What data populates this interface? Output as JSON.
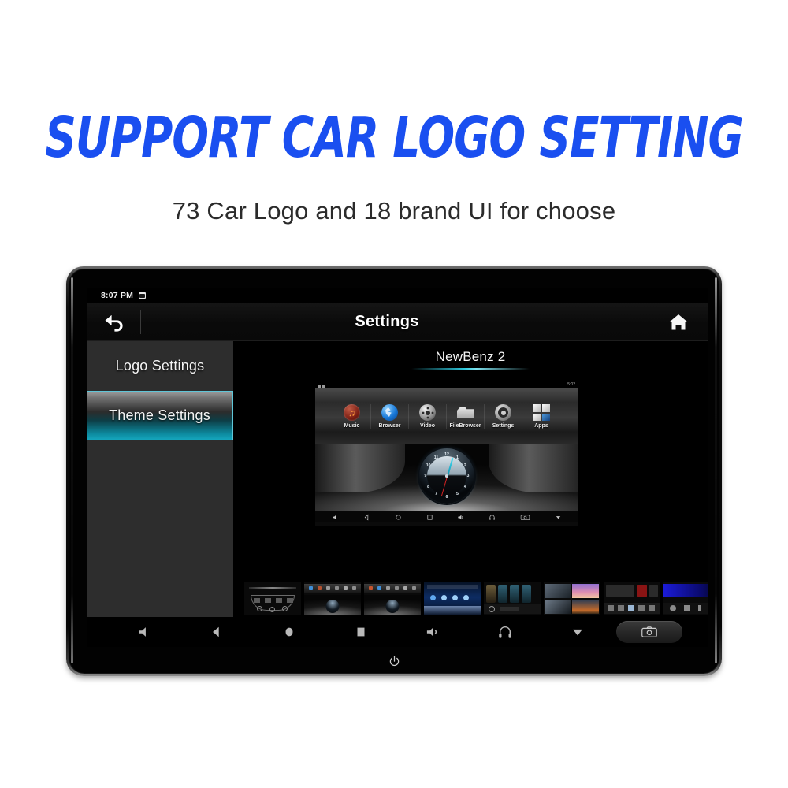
{
  "marketing": {
    "headline": "SUPPORT CAR LOGO SETTING",
    "subline": "73 Car Logo and 18 brand UI for choose",
    "headline_color": "#1a4ff0",
    "subline_color": "#2b2b2b"
  },
  "device": {
    "status_bar": {
      "time": "8:07 PM",
      "icon": "screenshot-icon"
    },
    "title_bar": {
      "back_icon": "back-arrow-icon",
      "title": "Settings",
      "home_icon": "home-icon"
    },
    "sidebar": {
      "items": [
        {
          "label": "Logo Settings",
          "selected": false
        },
        {
          "label": "Theme Settings",
          "selected": true
        }
      ],
      "selected_accent": "#14a6bd"
    },
    "panel": {
      "theme_name": "NewBenz 2",
      "preview": {
        "status": {
          "time": "5:02"
        },
        "apps": [
          {
            "label": "Music",
            "icon": "music-icon"
          },
          {
            "label": "Browser",
            "icon": "globe-icon"
          },
          {
            "label": "Video",
            "icon": "film-reel-icon"
          },
          {
            "label": "FileBrowser",
            "icon": "folder-icon"
          },
          {
            "label": "Settings",
            "icon": "gear-icon"
          },
          {
            "label": "Apps",
            "icon": "apps-grid-icon"
          }
        ],
        "clock_numbers": [
          "12",
          "1",
          "2",
          "3",
          "4",
          "5",
          "6",
          "7",
          "8",
          "9",
          "10",
          "11"
        ],
        "nav_icons": [
          "volume-down-icon",
          "back-icon",
          "home-icon",
          "recent-apps-icon",
          "volume-up-icon",
          "headphone-icon",
          "camera-icon",
          "dropdown-icon"
        ]
      },
      "thumbnails": [
        {
          "name": "theme-thumb-1",
          "style": "dashboard-knobs"
        },
        {
          "name": "theme-thumb-2",
          "style": "icons-clock"
        },
        {
          "name": "theme-thumb-3",
          "style": "icons-clock"
        },
        {
          "name": "theme-thumb-4",
          "style": "blue-row"
        },
        {
          "name": "theme-thumb-5",
          "style": "tiles-gauge"
        },
        {
          "name": "theme-thumb-6",
          "style": "photo-grid"
        },
        {
          "name": "theme-thumb-7",
          "style": "media-panel"
        },
        {
          "name": "theme-thumb-8",
          "style": "blue-glow"
        }
      ]
    },
    "bottom_nav": {
      "items": [
        "volume-down-icon",
        "back-icon",
        "home-icon",
        "recent-apps-icon",
        "volume-up-icon",
        "headphone-icon",
        "dropdown-icon"
      ],
      "camera_button": "camera-icon"
    },
    "power_icon": "power-icon"
  }
}
